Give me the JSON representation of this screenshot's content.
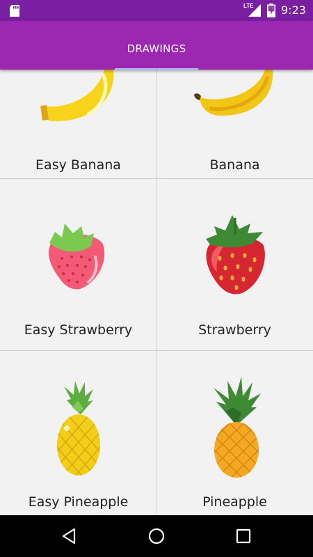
{
  "status_bar": {
    "network": "LTE",
    "time": "9:23"
  },
  "app_bar": {
    "tab_label": "DRAWINGS"
  },
  "drawings": [
    {
      "label": "Easy Banana",
      "icon": "easy-banana-icon"
    },
    {
      "label": "Banana",
      "icon": "banana-icon"
    },
    {
      "label": "Easy Strawberry",
      "icon": "easy-strawberry-icon"
    },
    {
      "label": "Strawberry",
      "icon": "strawberry-icon"
    },
    {
      "label": "Easy Pineapple",
      "icon": "easy-pineapple-icon"
    },
    {
      "label": "Pineapple",
      "icon": "pineapple-icon"
    }
  ],
  "colors": {
    "status_bar": "#7b1fa2",
    "app_bar": "#9c27b0",
    "tab_indicator": "#b3b8ff"
  }
}
